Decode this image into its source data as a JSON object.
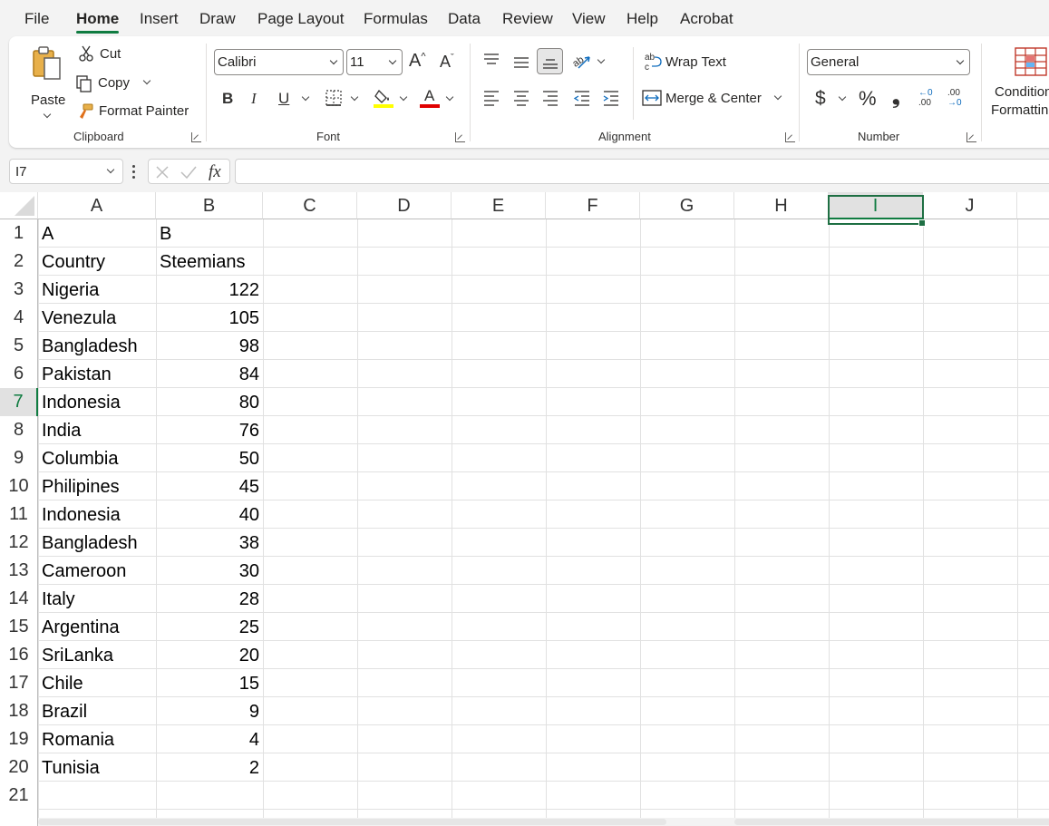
{
  "menu": {
    "tabs": [
      "File",
      "Home",
      "Insert",
      "Draw",
      "Page Layout",
      "Formulas",
      "Data",
      "Review",
      "View",
      "Help",
      "Acrobat"
    ],
    "active": "Home"
  },
  "ribbon": {
    "clipboard": {
      "label": "Clipboard",
      "paste": "Paste",
      "cut": "Cut",
      "copy": "Copy",
      "format_painter": "Format Painter"
    },
    "font": {
      "label": "Font",
      "family": "Calibri",
      "size": "11",
      "bold": "B",
      "italic": "I",
      "underline": "U",
      "grow": "A^",
      "shrink": "Aˇ",
      "highlight_color": "#ffff00",
      "font_color": "#e00000"
    },
    "alignment": {
      "label": "Alignment",
      "wrap_text": "Wrap Text",
      "merge_center": "Merge & Center"
    },
    "number": {
      "label": "Number",
      "format": "General",
      "currency": "$",
      "percent": "%",
      "comma": "❟",
      "increase_decimal_top": "←0",
      "increase_decimal_bottom": ".00",
      "decrease_decimal_top": ".00",
      "decrease_decimal_bottom": "→0"
    },
    "styles": {
      "conditional_line1": "Condition",
      "conditional_line2": "Formattin"
    }
  },
  "formula_bar": {
    "name_box": "I7",
    "formula": "",
    "fx_symbol": "fx"
  },
  "sheet": {
    "columns": [
      "A",
      "B",
      "C",
      "D",
      "E",
      "F",
      "G",
      "H",
      "I",
      "J"
    ],
    "selected_column": "I",
    "selected_row": 7,
    "row_numbers": [
      "1",
      "2",
      "3",
      "4",
      "5",
      "6",
      "7",
      "8",
      "9",
      "10",
      "11",
      "12",
      "13",
      "14",
      "15",
      "16",
      "17",
      "18",
      "19",
      "20",
      "21"
    ],
    "rows": [
      {
        "a": "A",
        "b": "B"
      },
      {
        "a": "Country",
        "b": "Steemians"
      },
      {
        "a": "Nigeria",
        "b": "122"
      },
      {
        "a": "Venezula",
        "b": "105"
      },
      {
        "a": "Bangladesh",
        "b": "98"
      },
      {
        "a": "Pakistan",
        "b": "84"
      },
      {
        "a": "Indonesia",
        "b": "80"
      },
      {
        "a": "India",
        "b": "76"
      },
      {
        "a": "Columbia",
        "b": "50"
      },
      {
        "a": "Philipines",
        "b": "45"
      },
      {
        "a": "Indonesia",
        "b": "40"
      },
      {
        "a": "Bangladesh",
        "b": "38"
      },
      {
        "a": "Cameroon",
        "b": "30"
      },
      {
        "a": "Italy",
        "b": "28"
      },
      {
        "a": "Argentina",
        "b": "25"
      },
      {
        "a": "SriLanka",
        "b": "20"
      },
      {
        "a": "Chile",
        "b": "15"
      },
      {
        "a": "Brazil",
        "b": "9"
      },
      {
        "a": "Romania",
        "b": "4"
      },
      {
        "a": "Tunisia",
        "b": "2"
      }
    ]
  }
}
